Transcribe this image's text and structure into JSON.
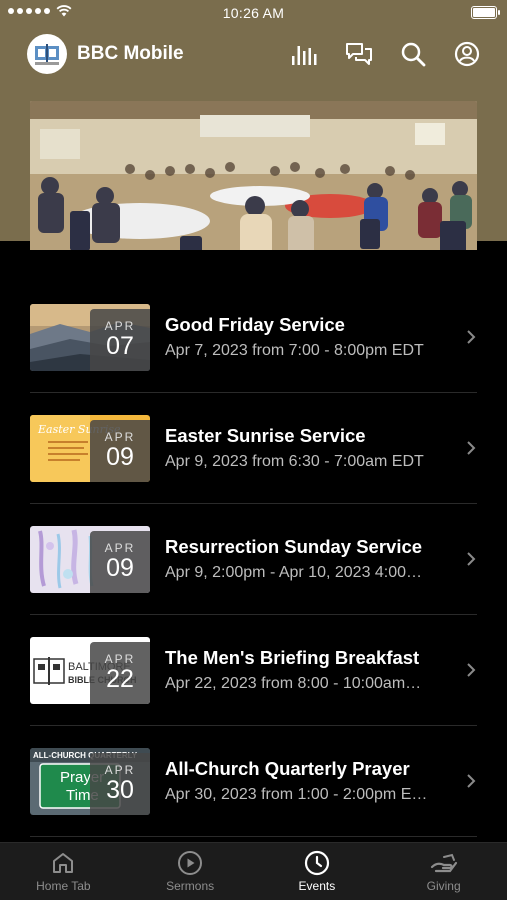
{
  "status_bar": {
    "time": "10:26 AM"
  },
  "header": {
    "app_title": "BBC Mobile",
    "icons": [
      "audio-bars-icon",
      "chat-icon",
      "search-icon",
      "profile-icon"
    ]
  },
  "hero": {
    "image": "church-fellowship-hall-photo"
  },
  "events": [
    {
      "title": "Good Friday Service",
      "subtitle": "Apr 7, 2023 from 7:00 - 8:00pm EDT",
      "month": "APR",
      "day": "07",
      "thumb": "mountain-sunset"
    },
    {
      "title": "Easter Sunrise Service",
      "subtitle": "Apr 9, 2023 from 6:30 - 7:00am EDT",
      "month": "APR",
      "day": "09",
      "thumb": "easter-flyer"
    },
    {
      "title": "Resurrection Sunday Service",
      "subtitle": "Apr 9, 2:00pm - Apr 10, 2023 4:00…",
      "month": "APR",
      "day": "09",
      "thumb": "watercolor"
    },
    {
      "title": "The Men's Briefing Breakfast",
      "subtitle": "Apr 22, 2023 from 8:00 - 10:00am…",
      "month": "APR",
      "day": "22",
      "thumb": "baltimore-bible-church-logo"
    },
    {
      "title": "All-Church Quarterly Prayer",
      "subtitle": "Apr 30, 2023 from 1:00 - 2:00pm E…",
      "month": "APR",
      "day": "30",
      "thumb": "prayer-time-sign"
    }
  ],
  "thumb_text": {
    "easter": "Easter Sunrise",
    "baltimore_1": "BALTIMORE",
    "baltimore_2": "BIBLE CHURCH",
    "quarterly": "ALL-CHURCH QUARTERLY",
    "prayer": "Prayer",
    "time": "Time"
  },
  "tabbar": {
    "tabs": [
      {
        "label": "Home Tab",
        "icon": "home-icon",
        "active": false
      },
      {
        "label": "Sermons",
        "icon": "play-circle-icon",
        "active": false
      },
      {
        "label": "Events",
        "icon": "clock-icon",
        "active": true
      },
      {
        "label": "Giving",
        "icon": "giving-hand-icon",
        "active": false
      }
    ]
  },
  "colors": {
    "header_bg": "#7a6d4d",
    "list_bg": "#000000",
    "tab_bg": "#1c1c1c",
    "subtitle": "#bdbdbd"
  }
}
